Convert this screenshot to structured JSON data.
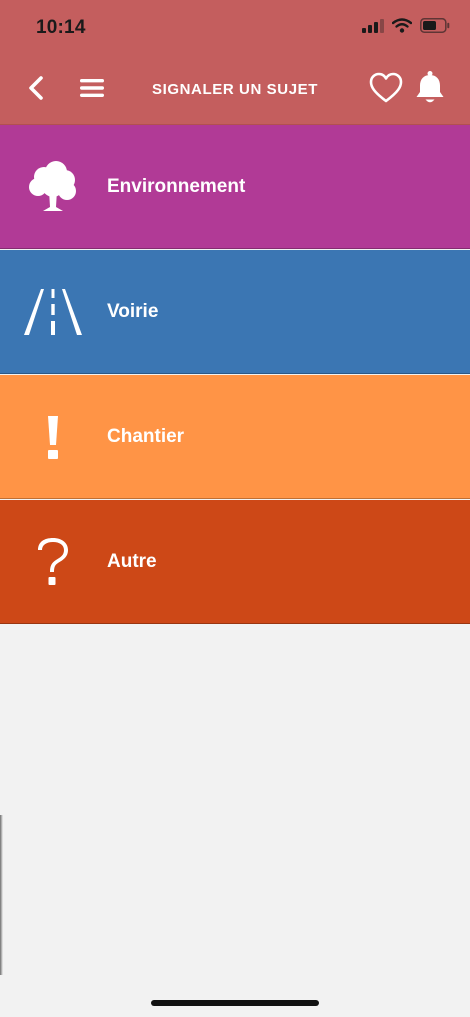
{
  "status_bar": {
    "time": "10:14",
    "icons": [
      "cellular-signal-icon",
      "wifi-icon",
      "battery-icon"
    ]
  },
  "navbar": {
    "title": "SIGNALER UN SUJET",
    "back_icon": "chevron-left-icon",
    "menu_icon": "hamburger-menu-icon",
    "favorite_icon": "heart-icon",
    "notification_icon": "bell-icon"
  },
  "categories": [
    {
      "label": "Environnement",
      "icon": "tree-icon",
      "color": "#b13a96"
    },
    {
      "label": "Voirie",
      "icon": "road-icon",
      "color": "#3b76b3"
    },
    {
      "label": "Chantier",
      "icon": "exclamation-icon",
      "color": "#ff9446"
    },
    {
      "label": "Autre",
      "icon": "question-mark-icon",
      "color": "#cd4817"
    }
  ],
  "colors": {
    "header": "#c45e5e",
    "background": "#f2f2f2"
  }
}
